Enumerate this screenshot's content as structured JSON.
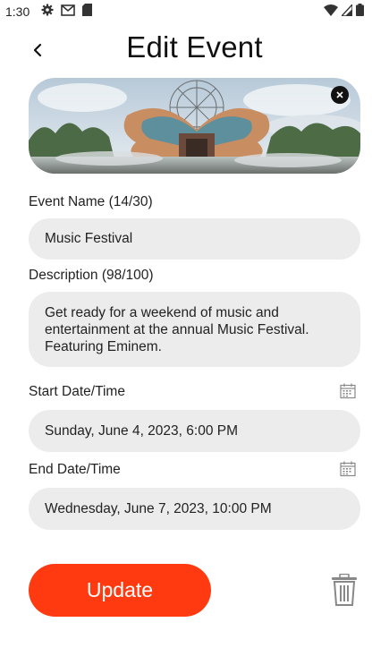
{
  "status_bar": {
    "time": "1:30",
    "icons": [
      "gear-icon",
      "gmail-icon",
      "sd-card-icon",
      "wifi-icon",
      "signal-icon",
      "battery-icon"
    ]
  },
  "header": {
    "title": "Edit Event",
    "back_icon": "chevron-left-icon"
  },
  "banner": {
    "close_icon": "close-icon"
  },
  "form": {
    "event_name_label": "Event Name (14/30)",
    "event_name_value": "Music Festival",
    "description_label": "Description (98/100)",
    "description_value": "Get ready for a weekend of music and entertainment at the annual Music Festival. Featuring Eminem.",
    "start_label": "Start Date/Time",
    "start_value": "Sunday, June 4, 2023, 6:00 PM",
    "end_label": "End Date/Time",
    "end_value": "Wednesday, June 7, 2023, 10:00 PM",
    "calendar_icon": "calendar-icon"
  },
  "actions": {
    "update_label": "Update",
    "delete_icon": "trash-icon"
  },
  "colors": {
    "accent": "#ff3a10",
    "field_bg": "#ececec"
  }
}
